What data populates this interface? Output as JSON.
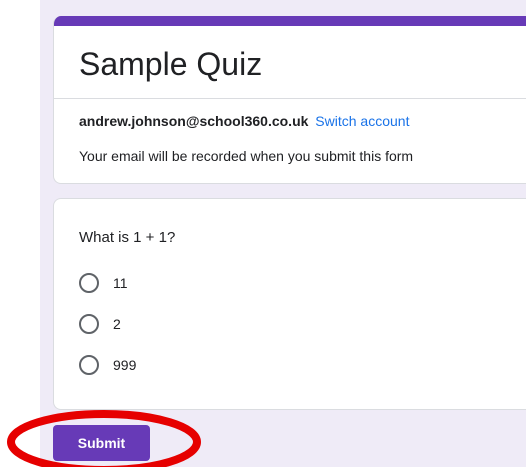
{
  "form": {
    "title": "Sample Quiz",
    "account_email": "andrew.johnson@school360.co.uk",
    "switch_account_label": "Switch account",
    "record_note": "Your email will be recorded when you submit this form"
  },
  "question": {
    "text": "What is 1 + 1?",
    "options": [
      {
        "label": "11",
        "selected": false
      },
      {
        "label": "2",
        "selected": false
      },
      {
        "label": "999",
        "selected": false
      }
    ]
  },
  "actions": {
    "submit_label": "Submit"
  },
  "colors": {
    "accent": "#673ab7",
    "link": "#1a73e8",
    "annotation": "#e60000",
    "background": "#efebf7"
  }
}
